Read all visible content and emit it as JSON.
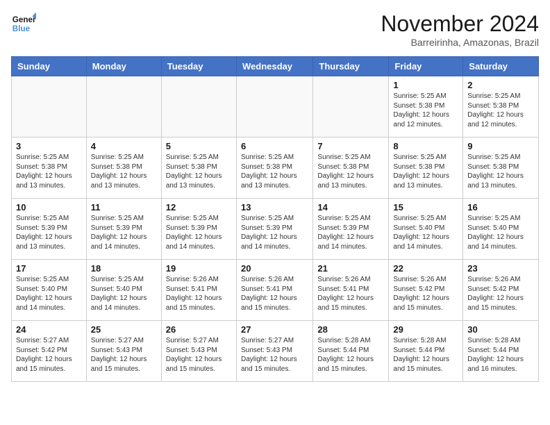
{
  "logo": {
    "line1": "General",
    "line2": "Blue"
  },
  "header": {
    "month": "November 2024",
    "location": "Barreirinha, Amazonas, Brazil"
  },
  "weekdays": [
    "Sunday",
    "Monday",
    "Tuesday",
    "Wednesday",
    "Thursday",
    "Friday",
    "Saturday"
  ],
  "weeks": [
    [
      {
        "day": "",
        "info": ""
      },
      {
        "day": "",
        "info": ""
      },
      {
        "day": "",
        "info": ""
      },
      {
        "day": "",
        "info": ""
      },
      {
        "day": "",
        "info": ""
      },
      {
        "day": "1",
        "info": "Sunrise: 5:25 AM\nSunset: 5:38 PM\nDaylight: 12 hours\nand 12 minutes."
      },
      {
        "day": "2",
        "info": "Sunrise: 5:25 AM\nSunset: 5:38 PM\nDaylight: 12 hours\nand 12 minutes."
      }
    ],
    [
      {
        "day": "3",
        "info": "Sunrise: 5:25 AM\nSunset: 5:38 PM\nDaylight: 12 hours\nand 13 minutes."
      },
      {
        "day": "4",
        "info": "Sunrise: 5:25 AM\nSunset: 5:38 PM\nDaylight: 12 hours\nand 13 minutes."
      },
      {
        "day": "5",
        "info": "Sunrise: 5:25 AM\nSunset: 5:38 PM\nDaylight: 12 hours\nand 13 minutes."
      },
      {
        "day": "6",
        "info": "Sunrise: 5:25 AM\nSunset: 5:38 PM\nDaylight: 12 hours\nand 13 minutes."
      },
      {
        "day": "7",
        "info": "Sunrise: 5:25 AM\nSunset: 5:38 PM\nDaylight: 12 hours\nand 13 minutes."
      },
      {
        "day": "8",
        "info": "Sunrise: 5:25 AM\nSunset: 5:38 PM\nDaylight: 12 hours\nand 13 minutes."
      },
      {
        "day": "9",
        "info": "Sunrise: 5:25 AM\nSunset: 5:38 PM\nDaylight: 12 hours\nand 13 minutes."
      }
    ],
    [
      {
        "day": "10",
        "info": "Sunrise: 5:25 AM\nSunset: 5:39 PM\nDaylight: 12 hours\nand 13 minutes."
      },
      {
        "day": "11",
        "info": "Sunrise: 5:25 AM\nSunset: 5:39 PM\nDaylight: 12 hours\nand 14 minutes."
      },
      {
        "day": "12",
        "info": "Sunrise: 5:25 AM\nSunset: 5:39 PM\nDaylight: 12 hours\nand 14 minutes."
      },
      {
        "day": "13",
        "info": "Sunrise: 5:25 AM\nSunset: 5:39 PM\nDaylight: 12 hours\nand 14 minutes."
      },
      {
        "day": "14",
        "info": "Sunrise: 5:25 AM\nSunset: 5:39 PM\nDaylight: 12 hours\nand 14 minutes."
      },
      {
        "day": "15",
        "info": "Sunrise: 5:25 AM\nSunset: 5:40 PM\nDaylight: 12 hours\nand 14 minutes."
      },
      {
        "day": "16",
        "info": "Sunrise: 5:25 AM\nSunset: 5:40 PM\nDaylight: 12 hours\nand 14 minutes."
      }
    ],
    [
      {
        "day": "17",
        "info": "Sunrise: 5:25 AM\nSunset: 5:40 PM\nDaylight: 12 hours\nand 14 minutes."
      },
      {
        "day": "18",
        "info": "Sunrise: 5:25 AM\nSunset: 5:40 PM\nDaylight: 12 hours\nand 14 minutes."
      },
      {
        "day": "19",
        "info": "Sunrise: 5:26 AM\nSunset: 5:41 PM\nDaylight: 12 hours\nand 15 minutes."
      },
      {
        "day": "20",
        "info": "Sunrise: 5:26 AM\nSunset: 5:41 PM\nDaylight: 12 hours\nand 15 minutes."
      },
      {
        "day": "21",
        "info": "Sunrise: 5:26 AM\nSunset: 5:41 PM\nDaylight: 12 hours\nand 15 minutes."
      },
      {
        "day": "22",
        "info": "Sunrise: 5:26 AM\nSunset: 5:42 PM\nDaylight: 12 hours\nand 15 minutes."
      },
      {
        "day": "23",
        "info": "Sunrise: 5:26 AM\nSunset: 5:42 PM\nDaylight: 12 hours\nand 15 minutes."
      }
    ],
    [
      {
        "day": "24",
        "info": "Sunrise: 5:27 AM\nSunset: 5:42 PM\nDaylight: 12 hours\nand 15 minutes."
      },
      {
        "day": "25",
        "info": "Sunrise: 5:27 AM\nSunset: 5:43 PM\nDaylight: 12 hours\nand 15 minutes."
      },
      {
        "day": "26",
        "info": "Sunrise: 5:27 AM\nSunset: 5:43 PM\nDaylight: 12 hours\nand 15 minutes."
      },
      {
        "day": "27",
        "info": "Sunrise: 5:27 AM\nSunset: 5:43 PM\nDaylight: 12 hours\nand 15 minutes."
      },
      {
        "day": "28",
        "info": "Sunrise: 5:28 AM\nSunset: 5:44 PM\nDaylight: 12 hours\nand 15 minutes."
      },
      {
        "day": "29",
        "info": "Sunrise: 5:28 AM\nSunset: 5:44 PM\nDaylight: 12 hours\nand 15 minutes."
      },
      {
        "day": "30",
        "info": "Sunrise: 5:28 AM\nSunset: 5:44 PM\nDaylight: 12 hours\nand 16 minutes."
      }
    ]
  ]
}
